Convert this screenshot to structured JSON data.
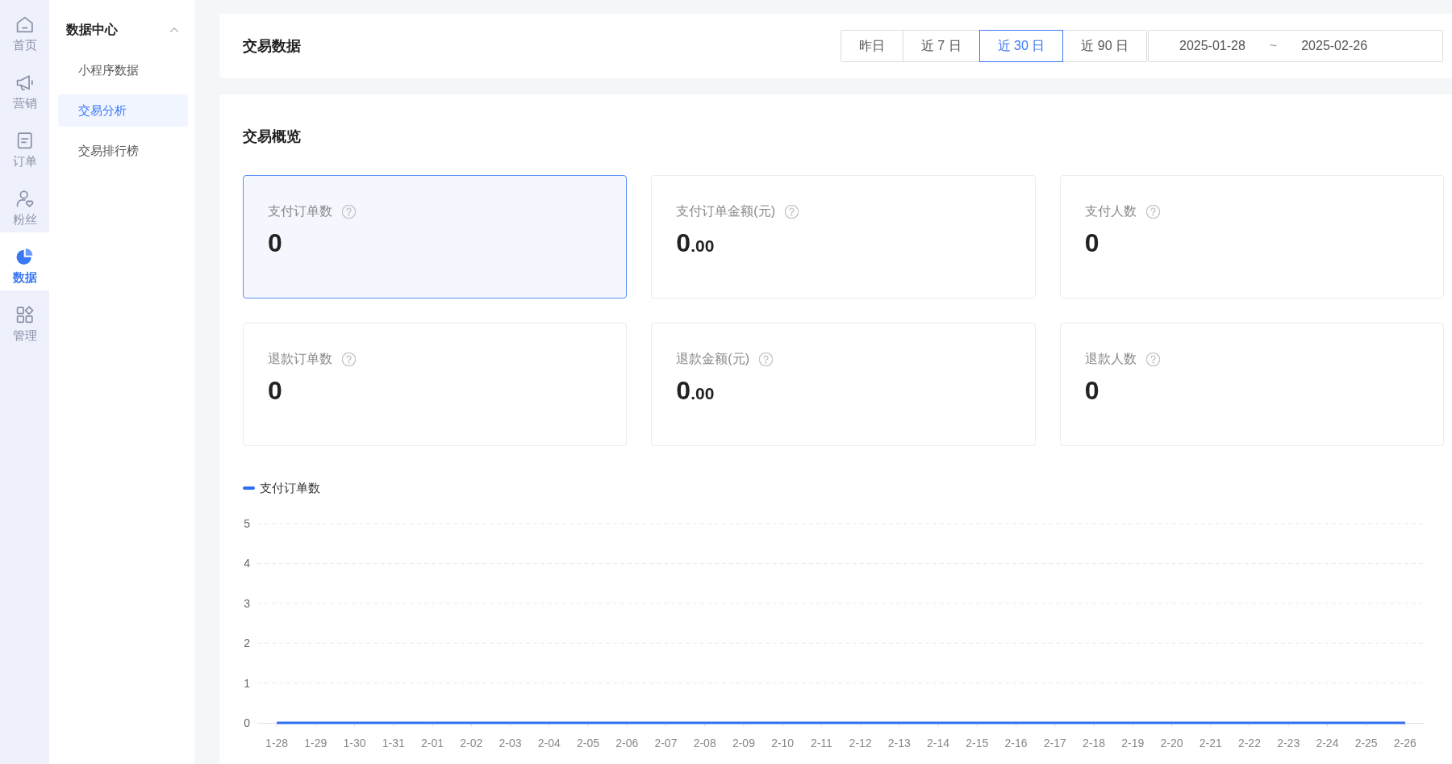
{
  "nav_rail": {
    "items": [
      {
        "label": "首页",
        "selected": false
      },
      {
        "label": "营销",
        "selected": false
      },
      {
        "label": "订单",
        "selected": false
      },
      {
        "label": "粉丝",
        "selected": false
      },
      {
        "label": "数据",
        "selected": true
      },
      {
        "label": "管理",
        "selected": false
      }
    ]
  },
  "submenu": {
    "title": "数据中心",
    "expanded": true,
    "items": [
      {
        "label": "小程序数据",
        "selected": false
      },
      {
        "label": "交易分析",
        "selected": true
      },
      {
        "label": "交易排行榜",
        "selected": false
      }
    ]
  },
  "header": {
    "title": "交易数据",
    "ranges": [
      {
        "label": "昨日",
        "selected": false
      },
      {
        "label": "近 7 日",
        "selected": false
      },
      {
        "label": "近 30 日",
        "selected": true
      },
      {
        "label": "近 90 日",
        "selected": false
      }
    ],
    "date_range": {
      "start": "2025-01-28",
      "separator": "~",
      "end": "2025-02-26"
    }
  },
  "overview": {
    "title": "交易概览",
    "metrics": [
      {
        "label": "支付订单数",
        "value": "0",
        "selected": true
      },
      {
        "label": "支付订单金额(元)",
        "value": "0",
        "decimals": ".00",
        "selected": false
      },
      {
        "label": "支付人数",
        "value": "0",
        "selected": false
      },
      {
        "label": "退款订单数",
        "value": "0",
        "selected": false
      },
      {
        "label": "退款金额(元)",
        "value": "0",
        "decimals": ".00",
        "selected": false
      },
      {
        "label": "退款人数",
        "value": "0",
        "selected": false
      }
    ],
    "chart_data": {
      "type": "line",
      "grid": true,
      "categories": [
        "1-28",
        "1-29",
        "1-30",
        "1-31",
        "2-01",
        "2-02",
        "2-03",
        "2-04",
        "2-05",
        "2-06",
        "2-07",
        "2-08",
        "2-09",
        "2-10",
        "2-11",
        "2-12",
        "2-13",
        "2-14",
        "2-15",
        "2-16",
        "2-17",
        "2-18",
        "2-19",
        "2-20",
        "2-21",
        "2-22",
        "2-23",
        "2-24",
        "2-25",
        "2-26"
      ],
      "series": [
        {
          "name": "支付订单数",
          "color": "#2f6ef5",
          "values": [
            0,
            0,
            0,
            0,
            0,
            0,
            0,
            0,
            0,
            0,
            0,
            0,
            0,
            0,
            0,
            0,
            0,
            0,
            0,
            0,
            0,
            0,
            0,
            0,
            0,
            0,
            0,
            0,
            0,
            0
          ]
        }
      ],
      "ylim": [
        0,
        5
      ],
      "yticks": [
        0,
        1,
        2,
        3,
        4,
        5
      ]
    }
  }
}
